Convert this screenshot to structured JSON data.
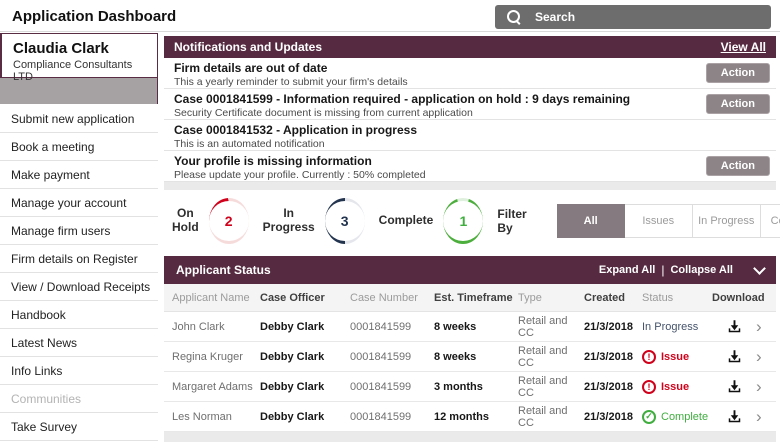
{
  "header": {
    "title": "Application Dashboard",
    "search_label": "Search"
  },
  "sidebar": {
    "user": {
      "name": "Claudia Clark",
      "company": "Compliance Consultants LTD"
    },
    "items": [
      {
        "label": "Submit new application"
      },
      {
        "label": "Book a meeting"
      },
      {
        "label": "Make payment"
      },
      {
        "label": "Manage your account"
      },
      {
        "label": "Manage firm users"
      },
      {
        "label": "Firm details on Register"
      },
      {
        "label": "View / Download Receipts"
      },
      {
        "label": "Handbook"
      },
      {
        "label": "Latest News"
      },
      {
        "label": "Info Links"
      },
      {
        "label": "Communities"
      },
      {
        "label": "Take Survey"
      }
    ]
  },
  "notifications": {
    "title": "Notifications and Updates",
    "view_all_label": "View All",
    "action_label": "Action",
    "items": [
      {
        "title": "Firm details are out of date",
        "subtitle": "This a yearly reminder to submit your firm's details"
      },
      {
        "title": "Case 0001841599 - Information required - application on hold : 9 days remaining",
        "subtitle": "Security Certificate document is missing from current application"
      },
      {
        "title": "Case 0001841532 - Application in progress",
        "subtitle": "This is an automated notification"
      },
      {
        "title": "Your profile is missing information",
        "subtitle": "Please update your profile. Currently : 50% completed"
      }
    ]
  },
  "counters": [
    {
      "label": "On Hold",
      "value": "2",
      "color": "#d0021b"
    },
    {
      "label": "In Progress",
      "value": "3",
      "color": "#23344e"
    },
    {
      "label": "Complete",
      "value": "1",
      "color": "#3fae3f"
    }
  ],
  "filter": {
    "label": "Filter By",
    "selected": "All",
    "options": [
      "All",
      "Issues",
      "In Progress",
      "Complete"
    ]
  },
  "applicant_status": {
    "title": "Applicant Status",
    "expand_label": "Expand All",
    "collapse_label": "Collapse All"
  },
  "table": {
    "headers": [
      "Applicant Name",
      "Case Officer",
      "Case Number",
      "Est. Timeframe",
      "Type",
      "Created",
      "Status",
      "Download"
    ],
    "rows": [
      {
        "applicant": "John Clark",
        "officer": "Debby Clark",
        "case_number": "0001841599",
        "timeframe": "8 weeks",
        "type": "Retail and CC",
        "created": "21/3/2018",
        "status": "In Progress"
      },
      {
        "applicant": "Regina Kruger",
        "officer": "Debby Clark",
        "case_number": "0001841599",
        "timeframe": "8 weeks",
        "type": "Retail and CC",
        "created": "21/3/2018",
        "status": "Issue"
      },
      {
        "applicant": "Margaret Adams",
        "officer": "Debby Clark",
        "case_number": "0001841599",
        "timeframe": "3 months",
        "type": "Retail and CC",
        "created": "21/3/2018",
        "status": "Issue"
      },
      {
        "applicant": "Les Norman",
        "officer": "Debby Clark",
        "case_number": "0001841599",
        "timeframe": "12 months",
        "type": "Retail and CC",
        "created": "21/3/2018",
        "status": "Complete"
      }
    ]
  },
  "colors": {
    "brand_maroon": "#562b41",
    "action_gray": "#8c8487",
    "issue_red": "#d0021b",
    "complete_green": "#3fae3f",
    "progress_navy": "#23344e"
  }
}
